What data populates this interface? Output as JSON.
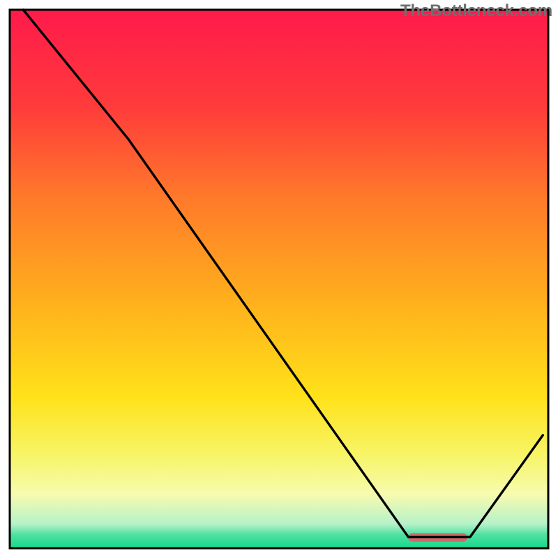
{
  "watermark": "TheBottleneck.com",
  "chart_data": {
    "type": "line",
    "title": "",
    "xlabel": "",
    "ylabel": "",
    "xlim": [
      0,
      100
    ],
    "ylim": [
      0,
      100
    ],
    "grid": false,
    "legend": false,
    "background": {
      "stops": [
        {
          "pos": 0.0,
          "color": "#ff1a4b"
        },
        {
          "pos": 0.18,
          "color": "#ff3b3b"
        },
        {
          "pos": 0.35,
          "color": "#ff7a2a"
        },
        {
          "pos": 0.55,
          "color": "#ffb21c"
        },
        {
          "pos": 0.72,
          "color": "#ffe21a"
        },
        {
          "pos": 0.83,
          "color": "#f7f56a"
        },
        {
          "pos": 0.9,
          "color": "#f7fbaf"
        },
        {
          "pos": 0.955,
          "color": "#b6f2c9"
        },
        {
          "pos": 0.975,
          "color": "#4fe0a0"
        },
        {
          "pos": 1.0,
          "color": "#14d98a"
        }
      ]
    },
    "series": [
      {
        "name": "curve",
        "stroke": "#000000",
        "strokeWidth": 3.4,
        "points": [
          {
            "x": 2.5,
            "y": 100.0
          },
          {
            "x": 22.0,
            "y": 76.0
          },
          {
            "x": 74.0,
            "y": 2.1
          },
          {
            "x": 85.5,
            "y": 2.1
          },
          {
            "x": 99.0,
            "y": 21.0
          }
        ]
      }
    ],
    "markers": [
      {
        "name": "highlight-bar",
        "shape": "rounded-rect",
        "fill": "#cf6a6a",
        "x0": 74.0,
        "x1": 85.0,
        "y_center": 2.0,
        "thickness_frac": 0.016
      }
    ],
    "frame": {
      "color": "#000000",
      "width": 3
    }
  }
}
